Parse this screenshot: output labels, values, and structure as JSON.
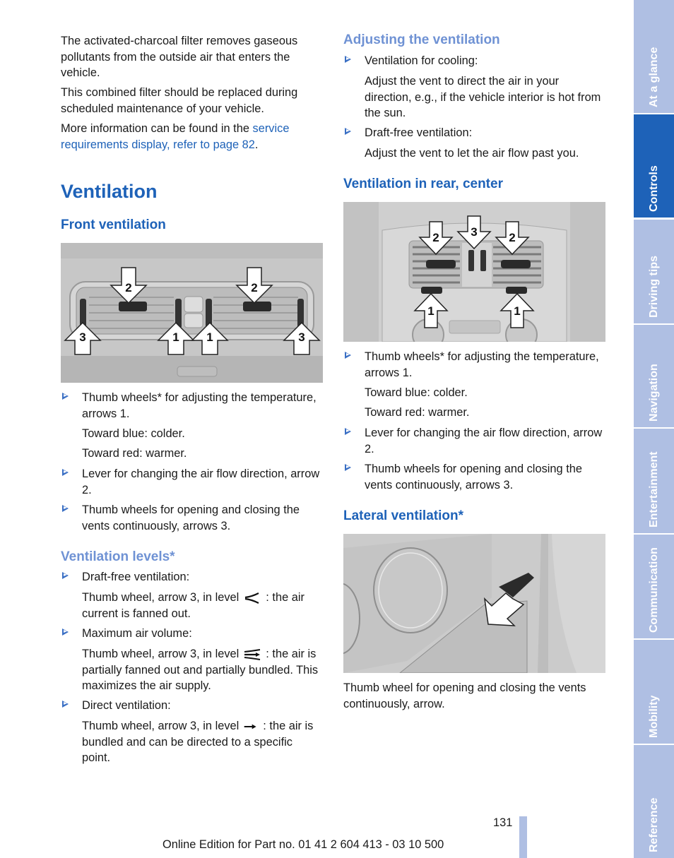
{
  "left": {
    "intro": [
      "The activated-charcoal filter removes gaseous pollutants from the outside air that enters the vehicle.",
      "This combined filter should be replaced during scheduled maintenance of your vehicle."
    ],
    "more_info_prefix": "More information can be found in the ",
    "more_info_link": "service requirements display, refer to page 82",
    "more_info_suffix": ".",
    "title": "Ventilation",
    "front": {
      "heading": "Front ventilation",
      "figure_labels": [
        "2",
        "2",
        "3",
        "1",
        "1",
        "3"
      ],
      "bullets": [
        {
          "text": "Thumb wheels* for adjusting the temperature, arrows 1.",
          "subs": [
            "Toward blue: colder.",
            "Toward red: warmer."
          ]
        },
        {
          "text": "Lever for changing the air flow direction, arrow 2."
        },
        {
          "text": "Thumb wheels for opening and closing the vents continuously, arrows 3."
        }
      ]
    },
    "levels": {
      "heading": "Ventilation levels*",
      "items": [
        {
          "label": "Draft-free ventilation:",
          "pre": "Thumb wheel, arrow 3, in level",
          "icon": "fanned-out-icon",
          "post": ": the air current is fanned out."
        },
        {
          "label": "Maximum air volume:",
          "pre": "Thumb wheel, arrow 3, in level",
          "icon": "partially-bundled-icon",
          "post": ": the air is partially fanned out and partially bundled. This maximizes the air supply."
        },
        {
          "label": "Direct ventilation:",
          "pre": "Thumb wheel, arrow 3, in level",
          "icon": "bundled-arrow-icon",
          "post": ": the air is bundled and can be directed to a specific point."
        }
      ]
    }
  },
  "right": {
    "adjust": {
      "heading": "Adjusting the ventilation",
      "items": [
        {
          "label": "Ventilation for cooling:",
          "sub": "Adjust the vent to direct the air in your direction, e.g., if the vehicle interior is hot from the sun."
        },
        {
          "label": "Draft-free ventilation:",
          "sub": "Adjust the vent to let the air flow past you."
        }
      ]
    },
    "rear": {
      "heading": "Ventilation in rear, center",
      "figure_labels": [
        "2",
        "3",
        "2",
        "1",
        "1"
      ],
      "bullets": [
        {
          "text": "Thumb wheels* for adjusting the temperature, arrows 1.",
          "subs": [
            "Toward blue: colder.",
            "Toward red: warmer."
          ]
        },
        {
          "text": "Lever for changing the air flow direction, arrow 2."
        },
        {
          "text": "Thumb wheels for opening and closing the vents continuously, arrows 3."
        }
      ]
    },
    "lateral": {
      "heading": "Lateral ventilation*",
      "caption": "Thumb wheel for opening and closing the vents continuously, arrow."
    }
  },
  "sidebar": {
    "tabs": [
      {
        "label": "At a glance",
        "active": false
      },
      {
        "label": "Controls",
        "active": true
      },
      {
        "label": "Driving tips",
        "active": false
      },
      {
        "label": "Navigation",
        "active": false
      },
      {
        "label": "Entertainment",
        "active": false
      },
      {
        "label": "Communication",
        "active": false
      },
      {
        "label": "Mobility",
        "active": false
      },
      {
        "label": "Reference",
        "active": false
      }
    ]
  },
  "footer": {
    "page_number": "131",
    "edition": "Online Edition for Part no. 01 41 2 604 413 - 03 10 500"
  },
  "colors": {
    "heading_blue": "#1e62b8",
    "subheading_light_blue": "#6f92d4",
    "tab_inactive": "#afbfe3",
    "tab_active": "#1e62b8"
  }
}
